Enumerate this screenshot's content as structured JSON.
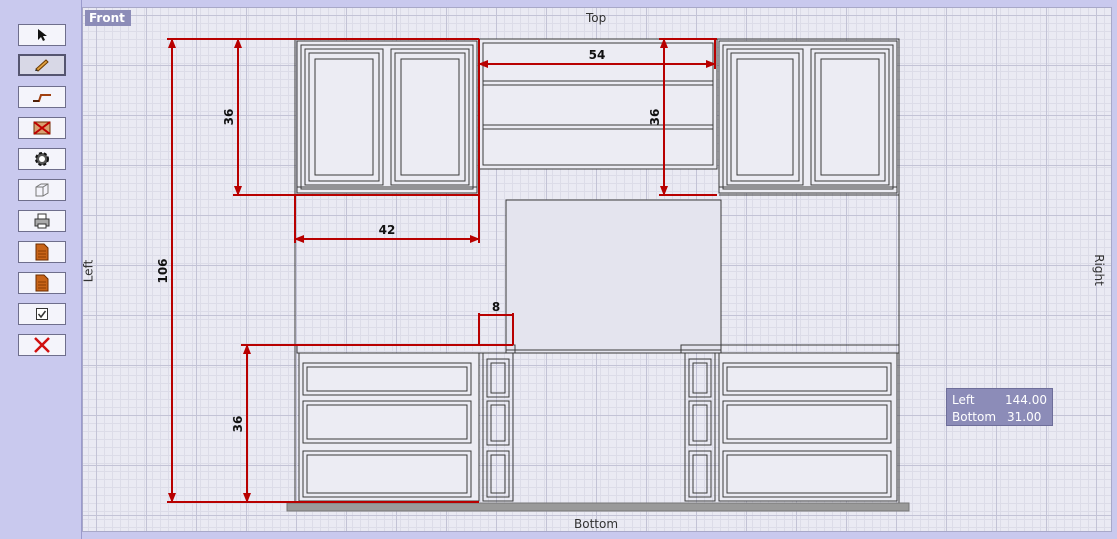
{
  "toolbar": {
    "tools": [
      {
        "name": "select-tool",
        "icon": "arrow-cursor-icon",
        "active": false
      },
      {
        "name": "draw-tool",
        "icon": "pencil-icon",
        "active": true
      },
      {
        "name": "stairs-tool",
        "icon": "stairs-icon",
        "active": false
      },
      {
        "name": "delete-cabinet-tool",
        "icon": "delete-cabinet-icon",
        "active": false
      },
      {
        "name": "hardware-tool",
        "icon": "gear-icon",
        "active": false
      },
      {
        "name": "3d-view-tool",
        "icon": "3d-box-icon",
        "active": false
      },
      {
        "name": "print-tool",
        "icon": "printer-icon",
        "active": false
      },
      {
        "name": "report-tool",
        "icon": "document-icon",
        "active": false
      },
      {
        "name": "export-tool",
        "icon": "document-icon",
        "active": false
      },
      {
        "name": "checkbox-tool",
        "icon": "checkbox-icon",
        "active": false
      },
      {
        "name": "close-tool",
        "icon": "close-icon",
        "active": false
      }
    ]
  },
  "view": {
    "tag": "Front",
    "top": "Top",
    "bottom": "Bottom",
    "left": "Left",
    "right": "Right"
  },
  "dimensions": {
    "upper_width": "54",
    "upper_height_right": "36",
    "upper_height_left": "36",
    "left_upper_width": "42",
    "overall_height": "106",
    "gap": "8",
    "base_height": "36"
  },
  "coords": {
    "left_label": "Left",
    "left_value": "144.00",
    "bottom_label": "Bottom",
    "bottom_value": "31.00"
  },
  "colors": {
    "dimension": "#b80000",
    "cabinet_line": "#3a3a3a",
    "floor": "#9a9a9a"
  }
}
